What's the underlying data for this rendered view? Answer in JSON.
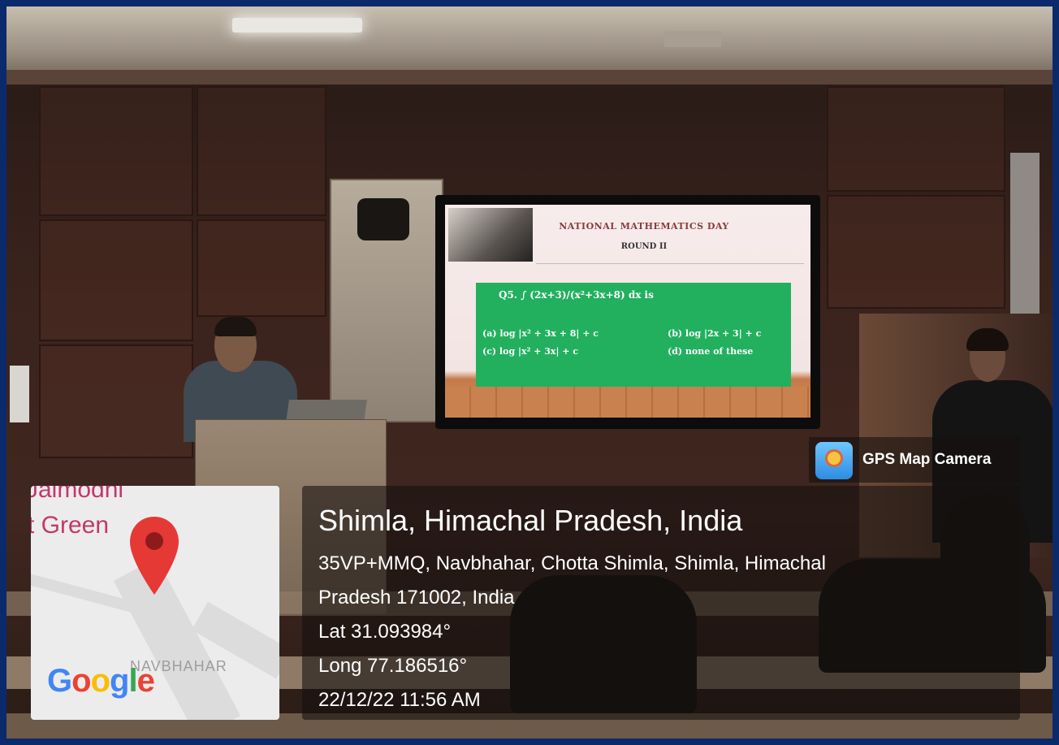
{
  "slide": {
    "title": "NATIONAL MATHEMATICS DAY",
    "round": "ROUND II",
    "question": "Q5. ∫ (2x+3)/(x²+3x+8) dx  is",
    "options": {
      "a": "(a) log |x² + 3x + 8| + c",
      "b": "(b) log |2x + 3| + c",
      "c": "(c) log |x² + 3x| + c",
      "d": "(d) none of these"
    }
  },
  "map": {
    "area_text_1": "Jaimodni",
    "area_text_2": "t Green",
    "locality": "NAVBHAHAR",
    "logo": "Google",
    "icons": {
      "pin": "map-pin-icon"
    }
  },
  "badge": {
    "label": "GPS Map Camera"
  },
  "location": {
    "title": "Shimla, Himachal Pradesh, India",
    "address_line_1": "35VP+MMQ, Navbhahar, Chotta Shimla, Shimla, Himachal",
    "address_line_2": "Pradesh 171002, India",
    "lat": "Lat 31.093984°",
    "long": "Long 77.186516°",
    "datetime": "22/12/22 11:56 AM"
  },
  "colors": {
    "slide_green": "#22b05f",
    "pin_red": "#e53935",
    "border_blue": "#0b2a6b"
  }
}
